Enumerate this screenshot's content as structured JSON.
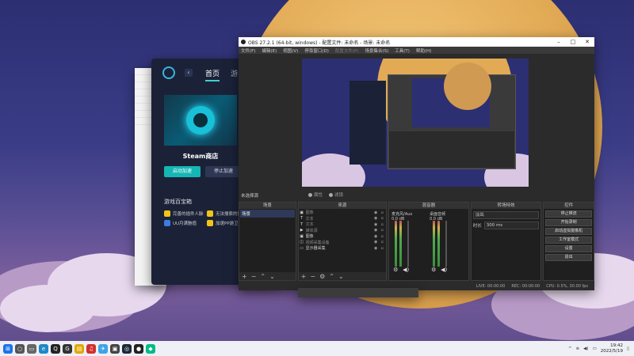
{
  "app": {
    "nav_home": "首页",
    "nav_more": "游",
    "title": "Steam商店",
    "start_btn": "启动加速",
    "stop_btn": "停止加速",
    "section": "游戏百宝箱",
    "tools": [
      "完善的插件人脉",
      "无法搜索的问题",
      "UU月满魅值",
      "加速PP游卫"
    ]
  },
  "obs": {
    "title": "OBS 27.2.1 (64-bit, windows) - 配置文件: 未命名 - 场景: 未命名",
    "menu": [
      "文件(F)",
      "编辑(E)",
      "视图(V)",
      "停靠窗口(D)",
      "配置文件(P)",
      "场景集合(S)",
      "工具(T)",
      "帮助(H)"
    ],
    "current_scene_label": "未选择源",
    "props_label": "属性",
    "filters_label": "滤镜",
    "docks": {
      "scenes": "场景",
      "sources": "来源",
      "mixer": "混音器",
      "transitions": "转场特效",
      "controls": "控件"
    },
    "scene_items": [
      "场景"
    ],
    "sources": [
      {
        "name": "图像",
        "icon": "image-icon",
        "dim": true
      },
      {
        "name": "文本",
        "icon": "text-icon",
        "dim": true
      },
      {
        "name": "文本",
        "icon": "text-icon",
        "dim": true
      },
      {
        "name": "媒体源",
        "icon": "media-icon",
        "dim": true
      },
      {
        "name": "图像",
        "icon": "image-icon",
        "dim": false
      },
      {
        "name": "视频采集设备",
        "icon": "camera-icon",
        "dim": true
      },
      {
        "name": "显示器采集",
        "icon": "monitor-icon",
        "dim": false
      }
    ],
    "mixer": [
      {
        "name": "麦克风/Aux",
        "db": "0.0 dB"
      },
      {
        "name": "桌面音频",
        "db": "0.0 dB"
      }
    ],
    "transition": {
      "type": "淡出",
      "duration_label": "时长",
      "duration_value": "300 ms"
    },
    "controls": [
      "停止推流",
      "开始录制",
      "启动虚拟摄像机",
      "工作室模式",
      "设置",
      "退出"
    ],
    "status": {
      "live": "LIVE: 00:00:00",
      "rec": "REC: 00:00:00",
      "cpu": "CPU: 0.5%, 30.00 fps"
    }
  },
  "taskbar": {
    "time": "19:42",
    "date": "2022/5/19",
    "icons": [
      "windows-icon",
      "search-icon",
      "taskview-icon",
      "edge-icon",
      "qq-icon",
      "app-icon",
      "file-icon",
      "netease-icon",
      "app2-icon",
      "bilibili-icon",
      "steam-icon",
      "obs-icon",
      "app3-icon"
    ]
  },
  "colors": {
    "accent_teal": "#15b6b4",
    "obs_bg": "#2b2b2b",
    "wallpaper": "#2d2f73",
    "moon": "#e2aa55"
  }
}
